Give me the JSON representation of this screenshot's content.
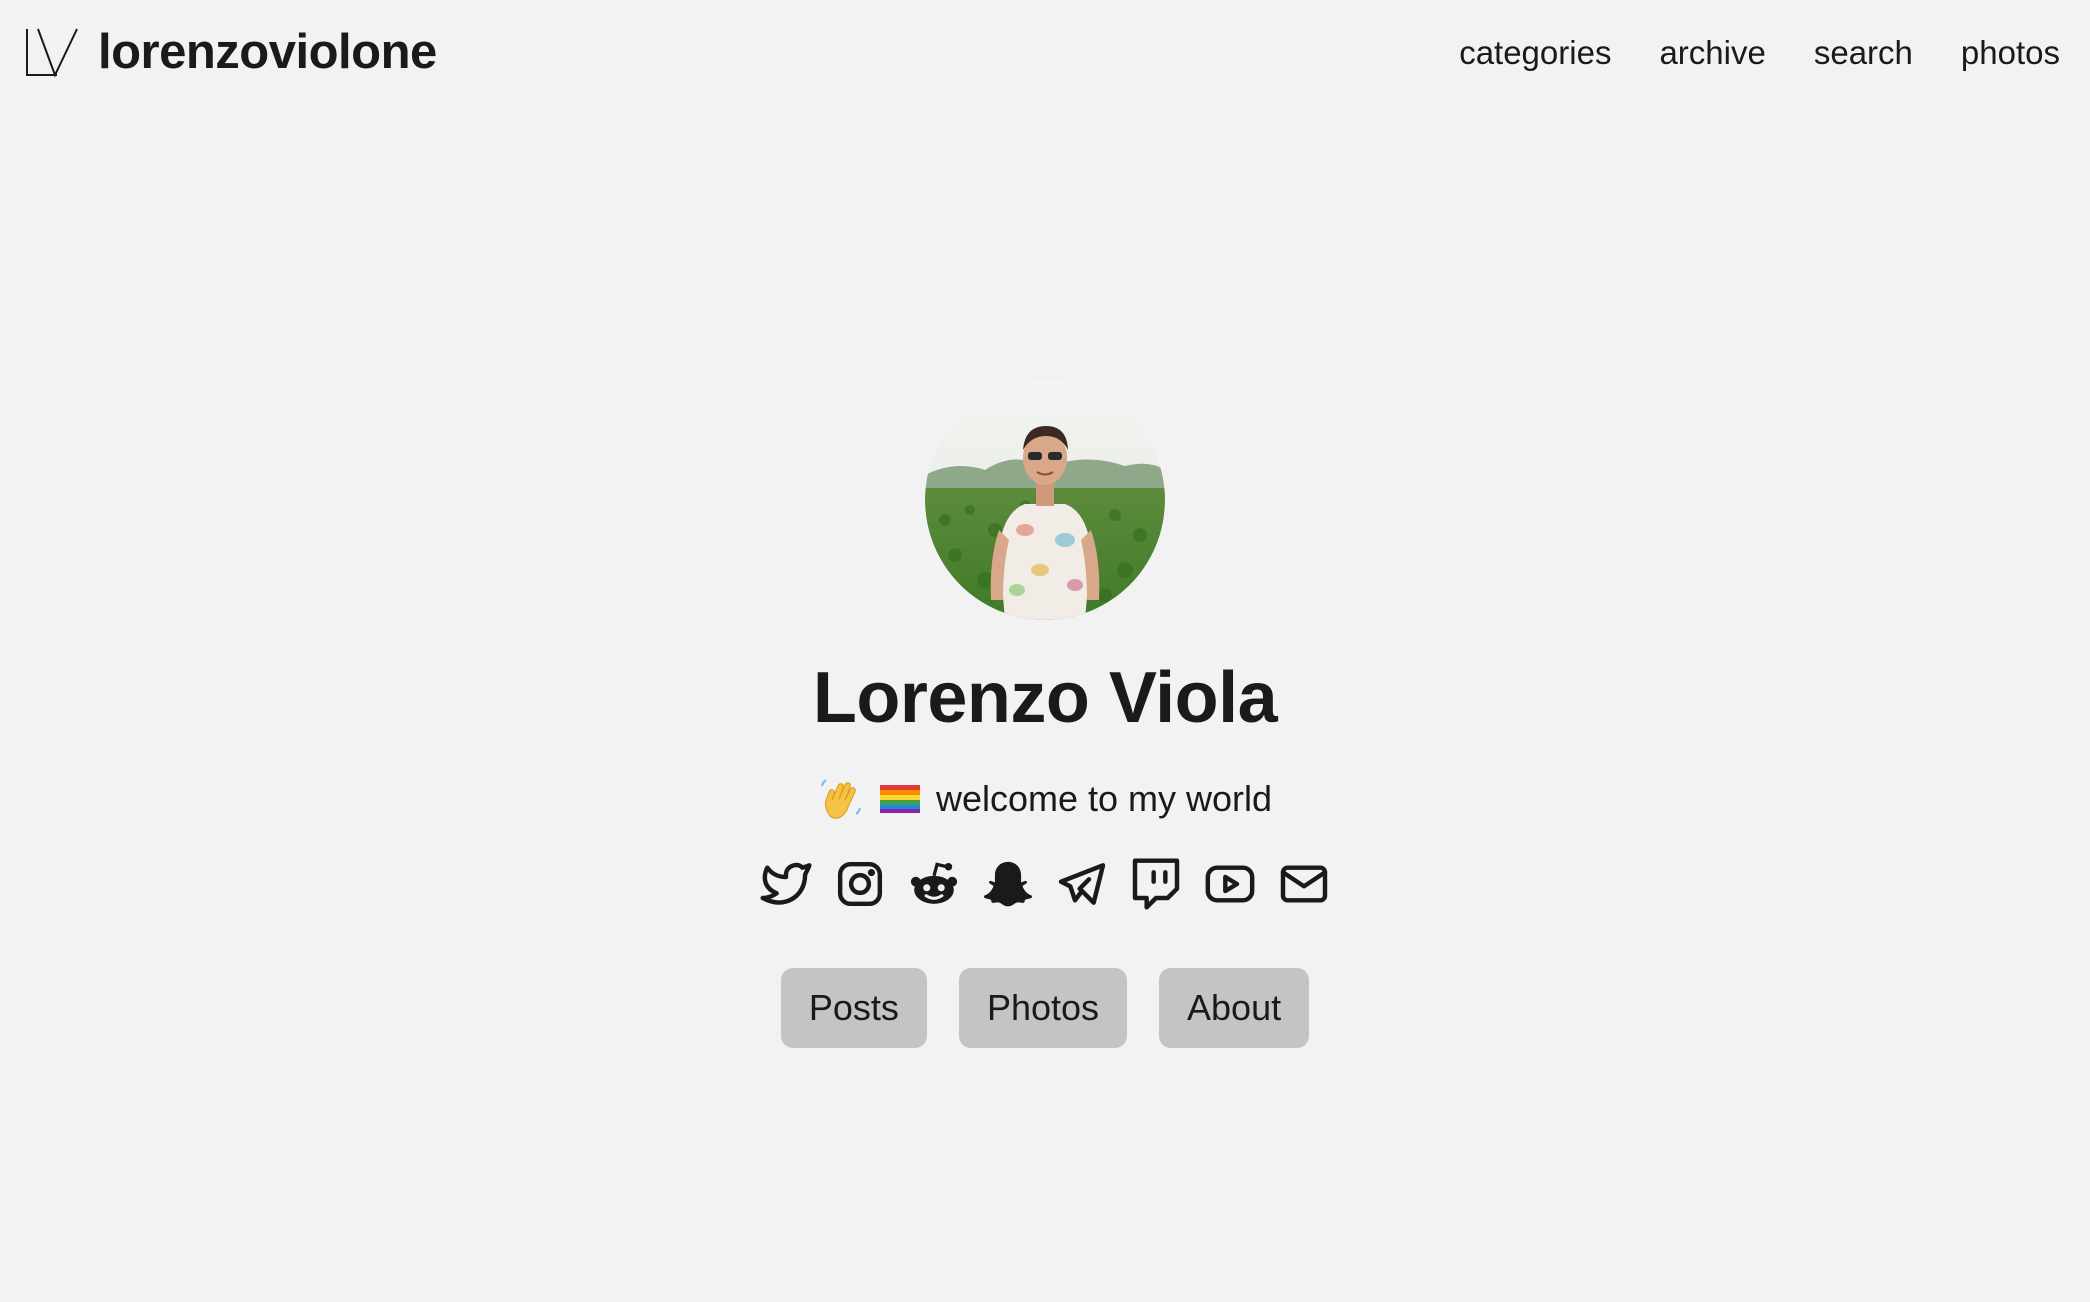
{
  "header": {
    "site_name": "lorenzoviolone",
    "nav": [
      {
        "label": "categories"
      },
      {
        "label": "archive"
      },
      {
        "label": "search"
      },
      {
        "label": "photos"
      }
    ]
  },
  "profile": {
    "name": "Lorenzo Viola",
    "tagline": "welcome to my world",
    "tagline_emojis": [
      "waving-hand",
      "rainbow-flag"
    ],
    "social_icons": [
      "twitter-icon",
      "instagram-icon",
      "reddit-icon",
      "snapchat-icon",
      "telegram-icon",
      "twitch-icon",
      "youtube-icon",
      "mail-icon"
    ],
    "buttons": [
      {
        "label": "Posts"
      },
      {
        "label": "Photos"
      },
      {
        "label": "About"
      }
    ]
  },
  "colors": {
    "background": "#f2f2f2",
    "text": "#1a1a1a",
    "button_bg": "#c4c4c4"
  }
}
